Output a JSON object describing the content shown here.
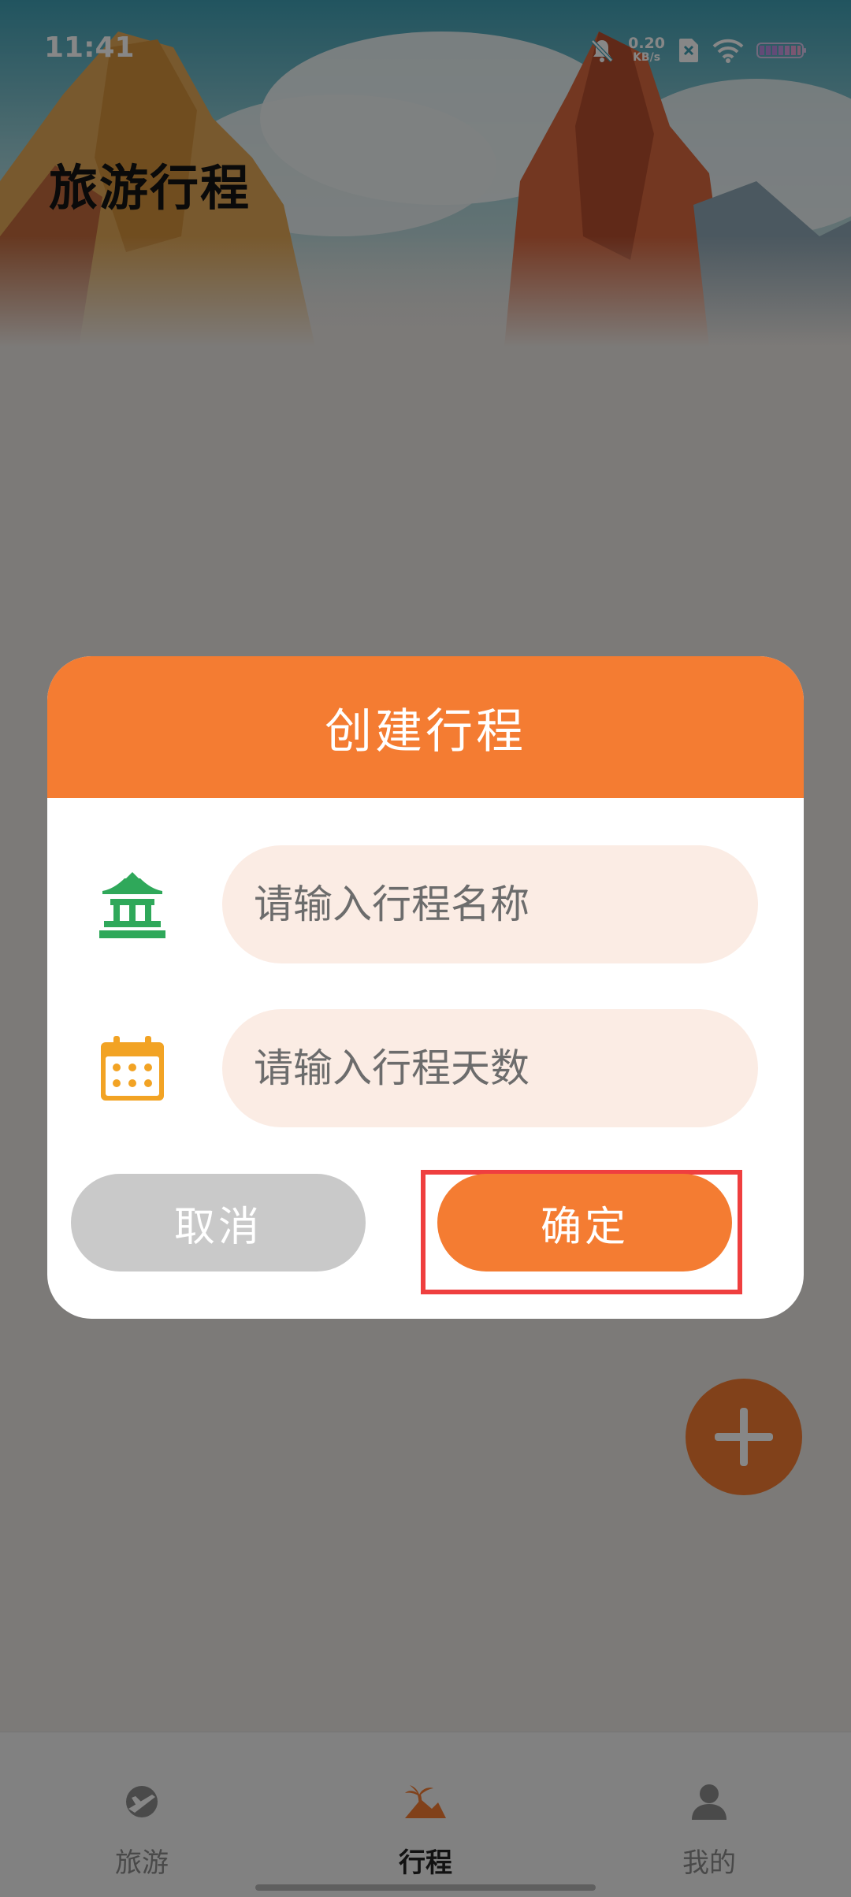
{
  "status_bar": {
    "time": "11:41",
    "net_speed_value": "0.20",
    "net_speed_unit": "KB/s",
    "icons": [
      "mute-bell-icon",
      "sim-off-icon",
      "wifi-icon",
      "battery-icon"
    ]
  },
  "page": {
    "title": "旅游行程"
  },
  "dialog": {
    "title": "创建行程",
    "name_input": {
      "placeholder": "请输入行程名称",
      "value": "",
      "icon": "pavilion-icon"
    },
    "days_input": {
      "placeholder": "请输入行程天数",
      "value": "",
      "icon": "calendar-icon"
    },
    "cancel_label": "取消",
    "confirm_label": "确定"
  },
  "fab": {
    "icon": "plus-icon"
  },
  "bottom_nav": {
    "items": [
      {
        "label": "旅游",
        "icon": "travel-plane-icon",
        "active": false
      },
      {
        "label": "行程",
        "icon": "palm-island-icon",
        "active": true
      },
      {
        "label": "我的",
        "icon": "user-icon",
        "active": false
      }
    ]
  },
  "colors": {
    "accent": "#f47c32",
    "input_bg": "#fbece4",
    "cancel_bg": "#c9c9c9",
    "highlight": "#ef3f3f",
    "pavilion_green": "#2fa85a",
    "calendar_orange": "#f2a324"
  }
}
